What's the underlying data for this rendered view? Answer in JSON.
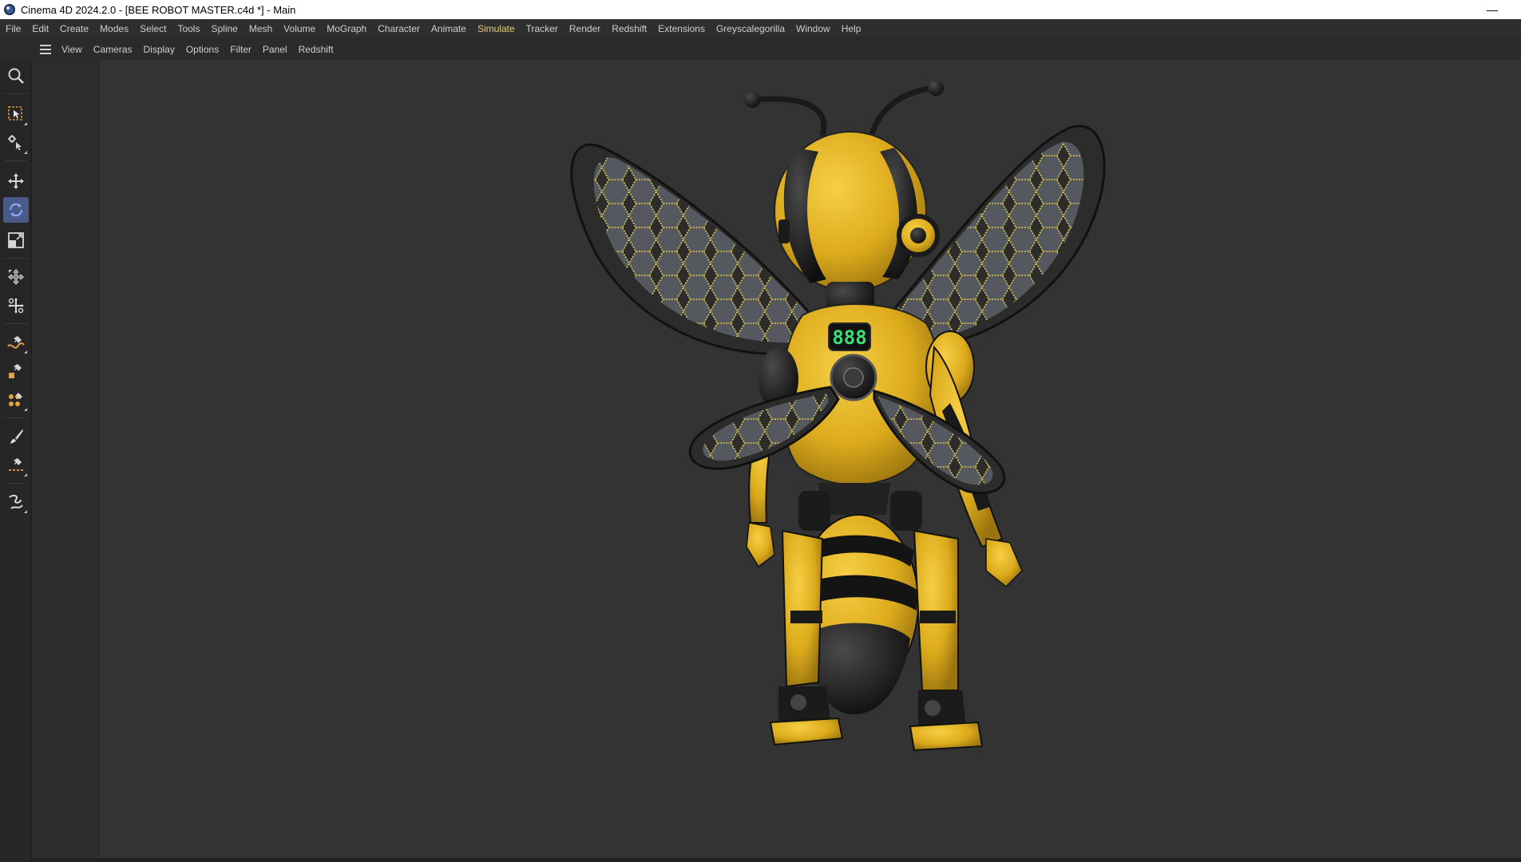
{
  "window": {
    "title": "Cinema 4D 2024.2.0 - [BEE ROBOT MASTER.c4d *] - Main",
    "minimize_glyph": "—"
  },
  "menu": {
    "items": [
      "File",
      "Edit",
      "Create",
      "Modes",
      "Select",
      "Tools",
      "Spline",
      "Mesh",
      "Volume",
      "MoGraph",
      "Character",
      "Animate",
      "Simulate",
      "Tracker",
      "Render",
      "Redshift",
      "Extensions",
      "Greyscalegorilla",
      "Window",
      "Help"
    ],
    "active_item": "Simulate"
  },
  "viewport_menu": {
    "items": [
      "View",
      "Cameras",
      "Display",
      "Options",
      "Filter",
      "Panel",
      "Redshift"
    ]
  },
  "toolbar": {
    "tools": [
      "search-icon",
      "live-selection-icon",
      "selection-tool-icon",
      "move-icon",
      "rotate-icon",
      "scale-icon",
      "transform-icon",
      "snap-icon",
      "spline-pen-icon",
      "polygon-pen-icon",
      "sculpt-icon",
      "brush-icon",
      "knife-icon",
      "weld-icon"
    ],
    "active_tool": "rotate-icon"
  },
  "display": {
    "bee_screen_text": "888"
  },
  "colors": {
    "accent": "#e8d16a",
    "active_tool_bg": "#4a5a8a",
    "bee_yellow": "#e2b21f",
    "bee_black": "#1b1b1b",
    "wing_edge": "#d8c24a",
    "screen_green": "#3ee07a"
  }
}
